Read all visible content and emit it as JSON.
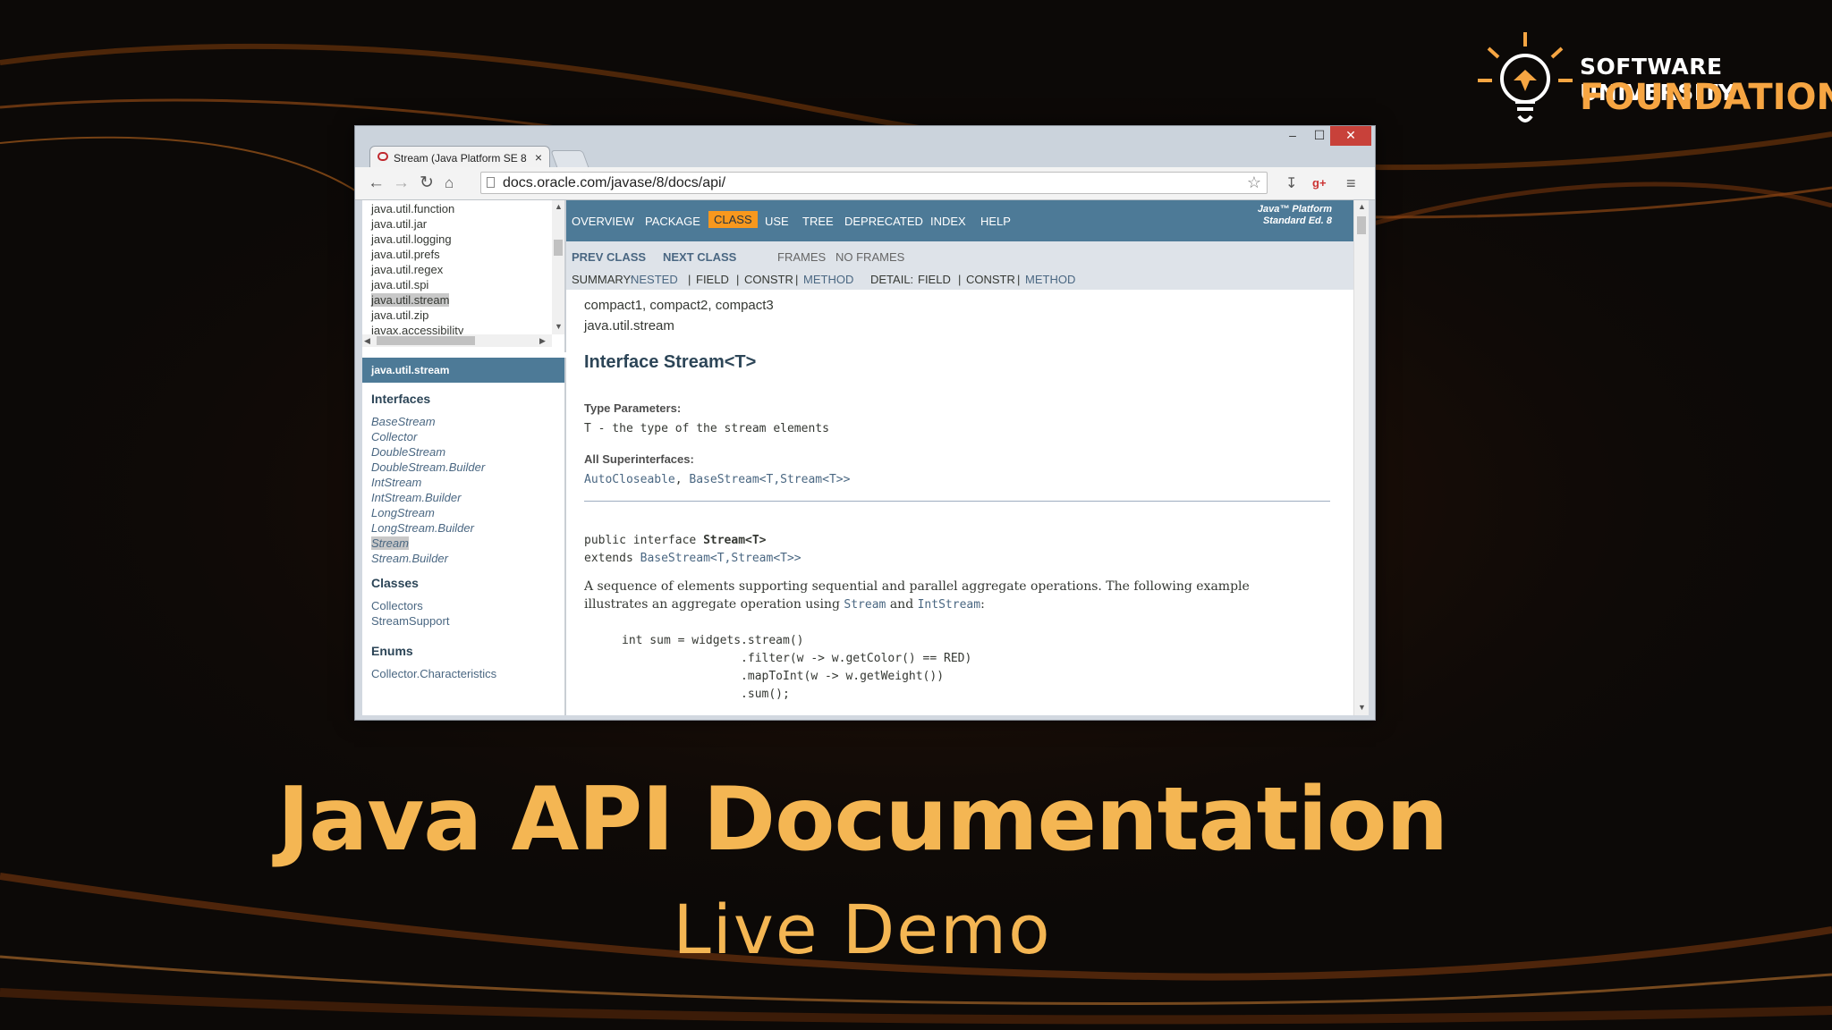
{
  "logo": {
    "line1": "SOFTWARE UNIVERSITY",
    "line2": "FOUNDATION"
  },
  "slide": {
    "title": "Java API Documentation",
    "subtitle": "Live Demo"
  },
  "browser": {
    "tab_title": "Stream (Java Platform SE 8",
    "tab_close": "×",
    "window_controls": {
      "minimize": "–",
      "maximize": "☐",
      "close": "✕"
    },
    "url": "docs.oracle.com/javase/8/docs/api/",
    "icons": {
      "back": "arrow-left-icon",
      "forward": "arrow-right-icon",
      "reload": "reload-icon",
      "home": "home-icon",
      "bookmark": "star-icon",
      "menu": "hamburger-menu-icon"
    }
  },
  "packages": [
    "java.util.function",
    "java.util.jar",
    "java.util.logging",
    "java.util.prefs",
    "java.util.regex",
    "java.util.spi",
    "java.util.stream",
    "java.util.zip",
    "javax.accessibility"
  ],
  "package_selected": "java.util.stream",
  "class_frame": {
    "header": "java.util.stream",
    "interfaces_heading": "Interfaces",
    "interfaces": [
      "BaseStream",
      "Collector",
      "DoubleStream",
      "DoubleStream.Builder",
      "IntStream",
      "IntStream.Builder",
      "LongStream",
      "LongStream.Builder",
      "Stream",
      "Stream.Builder"
    ],
    "interface_selected": "Stream",
    "classes_heading": "Classes",
    "classes": [
      "Collectors",
      "StreamSupport"
    ],
    "enums_heading": "Enums",
    "enums": [
      "Collector.Characteristics"
    ]
  },
  "topnav": {
    "items": [
      "OVERVIEW",
      "PACKAGE",
      "CLASS",
      "USE",
      "TREE",
      "DEPRECATED",
      "INDEX",
      "HELP"
    ],
    "active": "CLASS",
    "platform_line1": "Java™ Platform",
    "platform_line2": "Standard Ed. 8"
  },
  "subnav": {
    "prev": "PREV CLASS",
    "next": "NEXT CLASS",
    "frames": "FRAMES",
    "no_frames": "NO FRAMES",
    "summary_label": "SUMMARY:",
    "nested": "NESTED",
    "field": "FIELD",
    "constr": "CONSTR",
    "method": "METHOD",
    "detail_label": "DETAIL:",
    "sep": "|"
  },
  "doc": {
    "profiles": "compact1, compact2, compact3",
    "package": "java.util.stream",
    "title": "Interface Stream<T>",
    "type_params_label": "Type Parameters:",
    "type_param_T": "T",
    "type_param_desc": " - the type of the stream elements",
    "superinterfaces_label": "All Superinterfaces:",
    "super1": "AutoCloseable",
    "super_sep": ", ",
    "super2": "BaseStream<T,Stream<T>>",
    "decl_public": "public interface ",
    "decl_name": "Stream<T>",
    "decl_extends": "extends ",
    "decl_base": "BaseStream<T,Stream<T>>",
    "desc1": "A sequence of elements supporting sequential and parallel aggregate operations. The following example",
    "desc2_a": "illustrates an aggregate operation using ",
    "desc2_stream": "Stream",
    "desc2_and": " and ",
    "desc2_intstream": "IntStream",
    "desc2_end": ":",
    "code": [
      "int sum = widgets.stream()",
      "                 .filter(w -> w.getColor() == RED)",
      "                 .mapToInt(w -> w.getWeight())",
      "                 .sum();"
    ]
  }
}
